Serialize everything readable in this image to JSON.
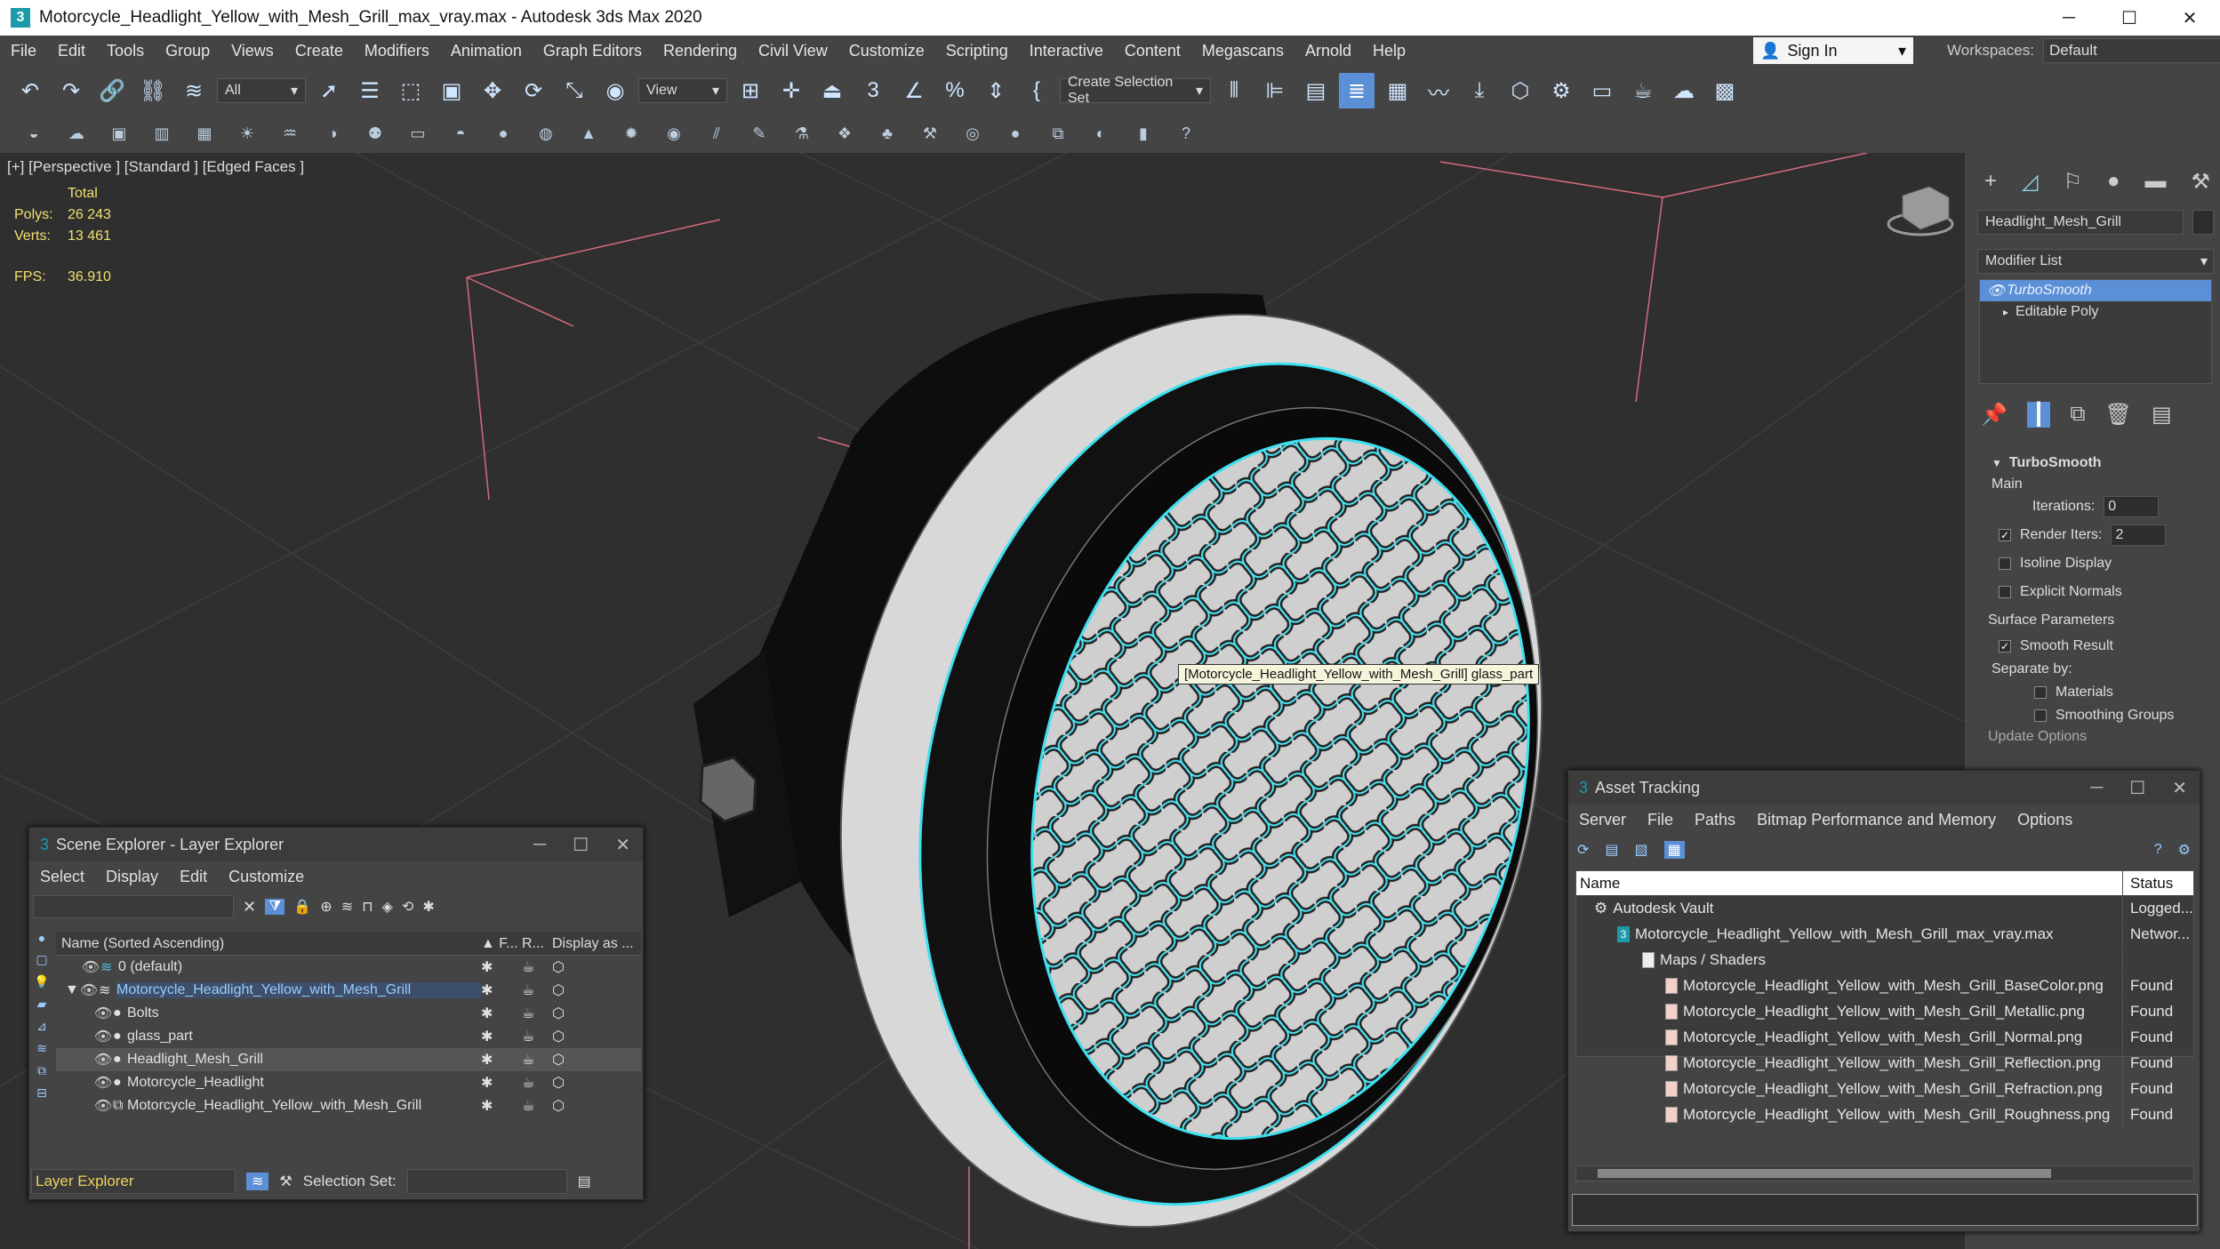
{
  "window": {
    "title": "Motorcycle_Headlight_Yellow_with_Mesh_Grill_max_vray.max - Autodesk 3ds Max 2020",
    "minimize": "─",
    "maximize": "☐",
    "close": "✕"
  },
  "menubar": [
    "File",
    "Edit",
    "Tools",
    "Group",
    "Views",
    "Create",
    "Modifiers",
    "Animation",
    "Graph Editors",
    "Rendering",
    "Civil View",
    "Customize",
    "Scripting",
    "Interactive",
    "Content",
    "Megascans",
    "Arnold",
    "Help"
  ],
  "signin": {
    "label": "Sign In"
  },
  "workspaces": {
    "label": "Workspaces:",
    "value": "Default"
  },
  "toolbar": {
    "filter": "All",
    "refcoord": "View",
    "selection_set": "Create Selection Set"
  },
  "viewport": {
    "label": "[+] [Perspective ] [Standard ] [Edged Faces ]",
    "stats": {
      "total": "Total",
      "polys_k": "Polys:",
      "polys_v": "26 243",
      "verts_k": "Verts:",
      "verts_v": "13 461",
      "fps_k": "FPS:",
      "fps_v": "36.910"
    },
    "tooltip": "[Motorcycle_Headlight_Yellow_with_Mesh_Grill] glass_part"
  },
  "command_panel": {
    "object_name": "Headlight_Mesh_Grill",
    "modifier_list": "Modifier List",
    "modifiers": [
      "TurboSmooth",
      "Editable Poly"
    ],
    "rollout": "TurboSmooth",
    "main": "Main",
    "iterations_k": "Iterations:",
    "iterations_v": "0",
    "render_iters_k": "Render Iters:",
    "render_iters_v": "2",
    "isoline": "Isoline Display",
    "explicit_normals": "Explicit Normals",
    "surface_params": "Surface Parameters",
    "smooth_result": "Smooth Result",
    "separate_by": "Separate by:",
    "materials": "Materials",
    "smoothing_groups": "Smoothing Groups",
    "update_options": "Update Options"
  },
  "scene_explorer": {
    "title": "Scene Explorer - Layer Explorer",
    "menu": [
      "Select",
      "Display",
      "Edit",
      "Customize"
    ],
    "col_name": "Name (Sorted Ascending)",
    "col_f": "▲ F...",
    "col_r": "R...",
    "col_display": "Display as ...",
    "rows": [
      {
        "name": "0 (default)"
      },
      {
        "name": "Motorcycle_Headlight_Yellow_with_Mesh_Grill"
      },
      {
        "name": "Bolts"
      },
      {
        "name": "glass_part"
      },
      {
        "name": "Headlight_Mesh_Grill"
      },
      {
        "name": "Motorcycle_Headlight"
      },
      {
        "name": "Motorcycle_Headlight_Yellow_with_Mesh_Grill"
      }
    ],
    "footer_layer": "Layer Explorer",
    "footer_selset": "Selection Set:"
  },
  "asset_tracking": {
    "title": "Asset Tracking",
    "menu": [
      "Server",
      "File",
      "Paths",
      "Bitmap Performance and Memory",
      "Options"
    ],
    "col_name": "Name",
    "col_status": "Status",
    "rows": [
      {
        "name": "Autodesk Vault",
        "status": "Logged..."
      },
      {
        "name": "Motorcycle_Headlight_Yellow_with_Mesh_Grill_max_vray.max",
        "status": "Networ..."
      },
      {
        "name": "Maps / Shaders",
        "status": ""
      },
      {
        "name": "Motorcycle_Headlight_Yellow_with_Mesh_Grill_BaseColor.png",
        "status": "Found"
      },
      {
        "name": "Motorcycle_Headlight_Yellow_with_Mesh_Grill_Metallic.png",
        "status": "Found"
      },
      {
        "name": "Motorcycle_Headlight_Yellow_with_Mesh_Grill_Normal.png",
        "status": "Found"
      },
      {
        "name": "Motorcycle_Headlight_Yellow_with_Mesh_Grill_Reflection.png",
        "status": "Found"
      },
      {
        "name": "Motorcycle_Headlight_Yellow_with_Mesh_Grill_Refraction.png",
        "status": "Found"
      },
      {
        "name": "Motorcycle_Headlight_Yellow_with_Mesh_Grill_Roughness.png",
        "status": "Found"
      }
    ]
  },
  "colors": {
    "accent": "#5b8fd6",
    "wire_select": "#3fe0f0",
    "grid": "#3a3a3a"
  }
}
